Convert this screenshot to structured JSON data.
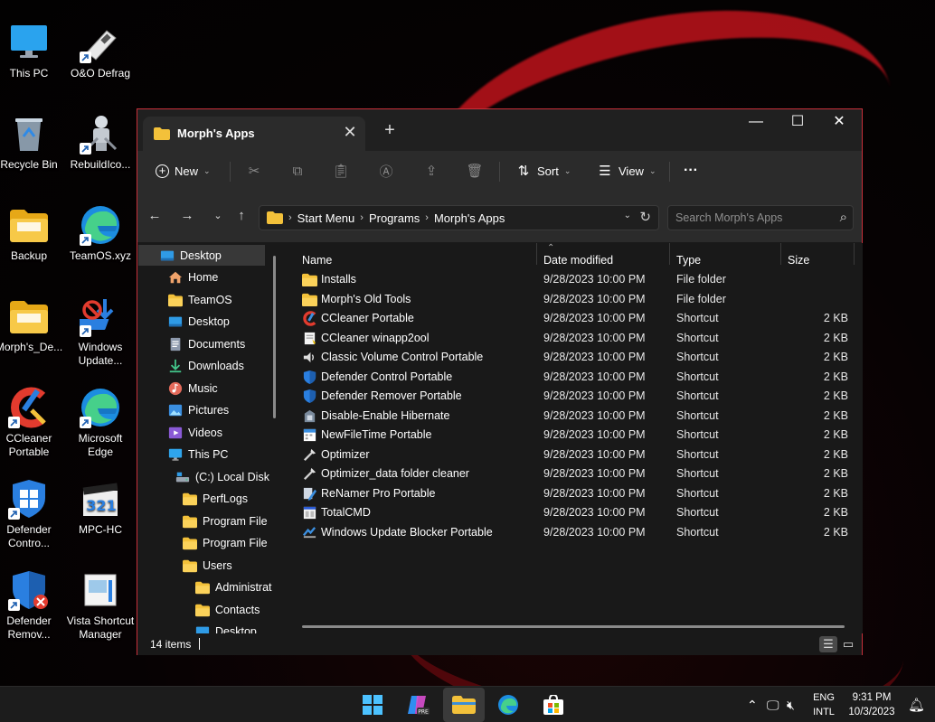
{
  "colors": {
    "accent_border": "#c8303a",
    "folder": "#f3c13a",
    "window_bg": "#191919",
    "toolbar_bg": "#2b2b2b",
    "taskbar_bg": "#1c1c1c"
  },
  "desktop_icons": [
    {
      "label": "This PC",
      "icon": "monitor-icon",
      "shortcut": false
    },
    {
      "label": "O&O Defrag",
      "icon": "defrag-icon",
      "shortcut": true
    },
    {
      "label": "Recycle Bin",
      "icon": "recycle-bin-icon",
      "shortcut": false
    },
    {
      "label": "RebuildIco...",
      "icon": "robot-icon",
      "shortcut": true
    },
    {
      "label": "Backup",
      "icon": "folder-icon",
      "shortcut": false
    },
    {
      "label": "TeamOS.xyz",
      "icon": "edge-icon",
      "shortcut": true
    },
    {
      "label": "Morph's_De...",
      "icon": "folder-icon",
      "shortcut": false
    },
    {
      "label": "Windows Update...",
      "icon": "windows-update-icon",
      "shortcut": true
    },
    {
      "label": "CCleaner Portable",
      "icon": "ccleaner-icon",
      "shortcut": true
    },
    {
      "label": "Microsoft Edge",
      "icon": "edge-icon",
      "shortcut": true
    },
    {
      "label": "Defender Contro...",
      "icon": "defender-icon",
      "shortcut": true
    },
    {
      "label": "MPC-HC",
      "icon": "mpc-icon",
      "shortcut": false
    },
    {
      "label": "Defender Remov...",
      "icon": "defender-remove-icon",
      "shortcut": true
    },
    {
      "label": "Vista Shortcut Manager",
      "icon": "vista-shortcut-icon",
      "shortcut": false
    }
  ],
  "window": {
    "tab_title": "Morph's Apps",
    "close_tab": "✕",
    "new_tab": "+",
    "controls": {
      "minimize": "—",
      "maximize": "☐",
      "close": "✕"
    }
  },
  "toolbar": {
    "new_label": "New",
    "sort_label": "Sort",
    "view_label": "View",
    "more_label": "···"
  },
  "address": {
    "crumbs": [
      "Start Menu",
      "Programs",
      "Morph's Apps"
    ],
    "search_placeholder": "Search Morph's Apps"
  },
  "nav": [
    {
      "label": "Desktop",
      "icon": "desktop-icon",
      "selected": true
    },
    {
      "label": "Home",
      "icon": "home-icon"
    },
    {
      "label": "TeamOS",
      "icon": "folder-icon"
    },
    {
      "label": "Desktop",
      "icon": "desktop-icon"
    },
    {
      "label": "Documents",
      "icon": "documents-icon"
    },
    {
      "label": "Downloads",
      "icon": "downloads-icon"
    },
    {
      "label": "Music",
      "icon": "music-icon"
    },
    {
      "label": "Pictures",
      "icon": "pictures-icon"
    },
    {
      "label": "Videos",
      "icon": "videos-icon"
    },
    {
      "label": "This PC",
      "icon": "monitor-icon"
    },
    {
      "label": "(C:) Local Disk",
      "icon": "drive-icon"
    },
    {
      "label": "PerfLogs",
      "icon": "folder-icon"
    },
    {
      "label": "Program File",
      "icon": "folder-icon"
    },
    {
      "label": "Program File",
      "icon": "folder-icon"
    },
    {
      "label": "Users",
      "icon": "folder-icon"
    },
    {
      "label": "Administrat",
      "icon": "folder-icon"
    },
    {
      "label": "Contacts",
      "icon": "folder-icon"
    },
    {
      "label": "Desktop",
      "icon": "desktop-icon"
    }
  ],
  "columns": {
    "name": "Name",
    "date": "Date modified",
    "type": "Type",
    "size": "Size"
  },
  "files": [
    {
      "name": "Installs",
      "date": "9/28/2023 10:00 PM",
      "type": "File folder",
      "size": "",
      "icon": "folder-icon"
    },
    {
      "name": "Morph's Old Tools",
      "date": "9/28/2023 10:00 PM",
      "type": "File folder",
      "size": "",
      "icon": "folder-icon"
    },
    {
      "name": "CCleaner Portable",
      "date": "9/28/2023 10:00 PM",
      "type": "Shortcut",
      "size": "2 KB",
      "icon": "ccleaner-icon"
    },
    {
      "name": "CCleaner winapp2ool",
      "date": "9/28/2023 10:00 PM",
      "type": "Shortcut",
      "size": "2 KB",
      "icon": "script-icon"
    },
    {
      "name": "Classic Volume Control Portable",
      "date": "9/28/2023 10:00 PM",
      "type": "Shortcut",
      "size": "2 KB",
      "icon": "volume-icon"
    },
    {
      "name": "Defender Control Portable",
      "date": "9/28/2023 10:00 PM",
      "type": "Shortcut",
      "size": "2 KB",
      "icon": "defender-icon"
    },
    {
      "name": "Defender Remover Portable",
      "date": "9/28/2023 10:00 PM",
      "type": "Shortcut",
      "size": "2 KB",
      "icon": "defender-icon"
    },
    {
      "name": "Disable-Enable Hibernate",
      "date": "9/28/2023 10:00 PM",
      "type": "Shortcut",
      "size": "2 KB",
      "icon": "hibernate-icon"
    },
    {
      "name": "NewFileTime Portable",
      "date": "9/28/2023 10:00 PM",
      "type": "Shortcut",
      "size": "2 KB",
      "icon": "filetime-icon"
    },
    {
      "name": "Optimizer",
      "date": "9/28/2023 10:00 PM",
      "type": "Shortcut",
      "size": "2 KB",
      "icon": "optimizer-icon"
    },
    {
      "name": "Optimizer_data folder cleaner",
      "date": "9/28/2023 10:00 PM",
      "type": "Shortcut",
      "size": "2 KB",
      "icon": "optimizer-icon"
    },
    {
      "name": "ReNamer Pro Portable",
      "date": "9/28/2023 10:00 PM",
      "type": "Shortcut",
      "size": "2 KB",
      "icon": "renamer-icon"
    },
    {
      "name": "TotalCMD",
      "date": "9/28/2023 10:00 PM",
      "type": "Shortcut",
      "size": "2 KB",
      "icon": "totalcmd-icon"
    },
    {
      "name": "Windows Update Blocker Portable",
      "date": "9/28/2023 10:00 PM",
      "type": "Shortcut",
      "size": "2 KB",
      "icon": "update-blocker-icon"
    }
  ],
  "status": {
    "item_count": "14 items"
  },
  "taskbar": {
    "apps": [
      "start-icon",
      "copilot-icon",
      "file-explorer-icon",
      "edge-icon",
      "store-icon"
    ],
    "lang_top": "ENG",
    "lang_bottom": "INTL",
    "time": "9:31 PM",
    "date": "10/3/2023"
  }
}
